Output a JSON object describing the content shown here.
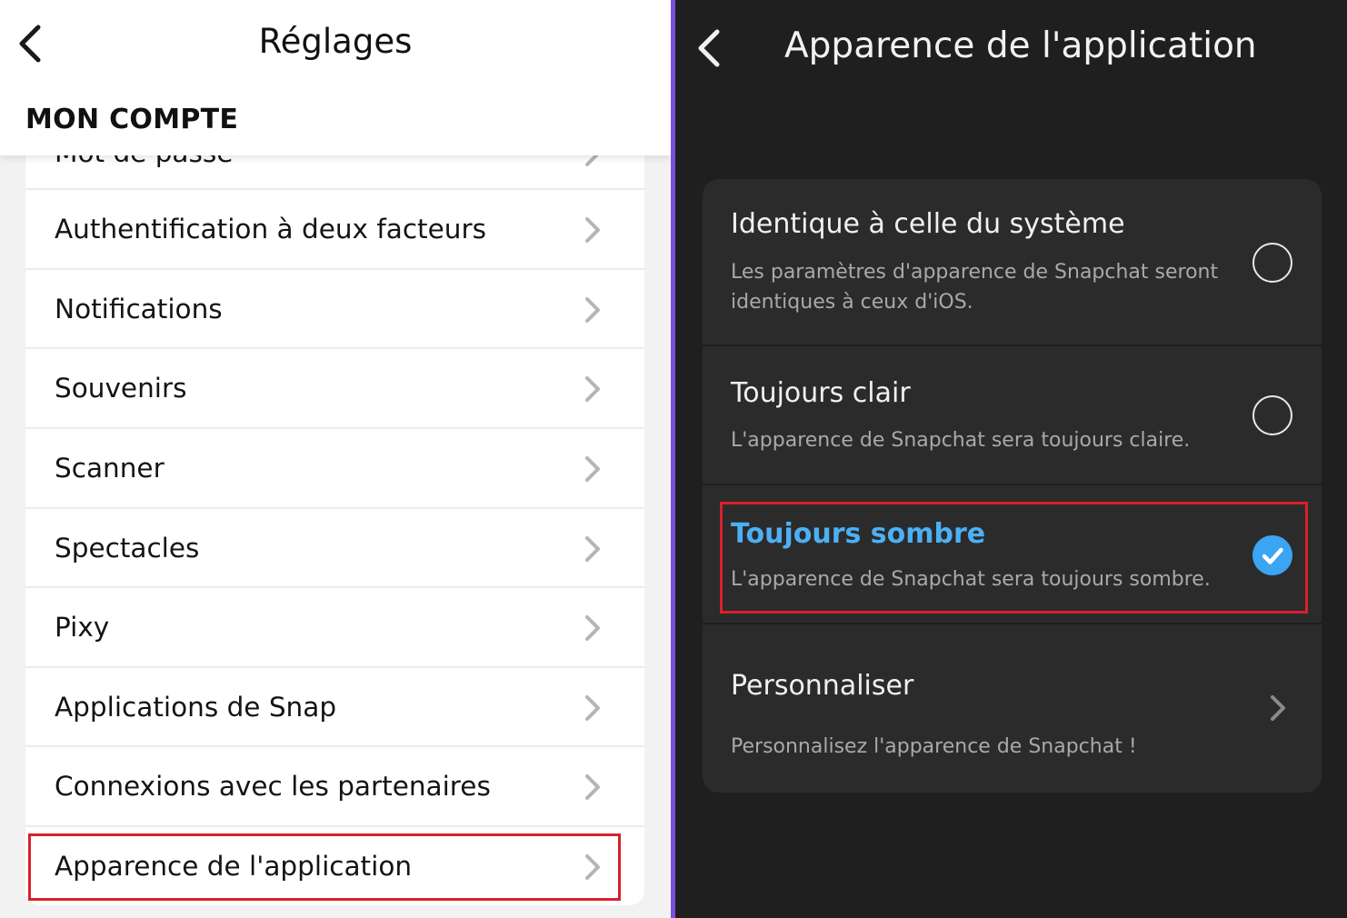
{
  "left_panel": {
    "title": "Réglages",
    "back_icon": "chevron-left-icon",
    "section_label": "MON COMPTE",
    "partial_item": "Mot de passe",
    "items": [
      {
        "label": "Authentification à deux facteurs"
      },
      {
        "label": "Notifications"
      },
      {
        "label": "Souvenirs"
      },
      {
        "label": "Scanner"
      },
      {
        "label": "Spectacles"
      },
      {
        "label": "Pixy"
      },
      {
        "label": "Applications de Snap"
      },
      {
        "label": "Connexions avec les partenaires"
      },
      {
        "label": "Apparence de l'application"
      }
    ],
    "highlighted_item": "Apparence de l'application"
  },
  "right_panel": {
    "title": "Apparence de l'application",
    "back_icon": "chevron-left-icon",
    "options": [
      {
        "title": "Identique à celle du système",
        "description_line1": "Les paramètres d'apparence de Snapchat seront",
        "description_line2": "identiques à ceux d'iOS.",
        "selected": false
      },
      {
        "title": "Toujours clair",
        "description": "L'apparence de Snapchat sera toujours claire.",
        "selected": false
      },
      {
        "title": "Toujours sombre",
        "description": "L'apparence de Snapchat sera toujours sombre.",
        "selected": true
      },
      {
        "title": "Personnaliser",
        "description": "Personnalisez l'apparence de Snapchat !",
        "selected": false
      }
    ]
  },
  "colors": {
    "accent_blue": "#3ba4f3",
    "highlight_red": "#d8212c",
    "divider_purple": "#7b4fe0",
    "dark_bg": "#1f1f1f",
    "dark_card": "#2b2b2b"
  }
}
